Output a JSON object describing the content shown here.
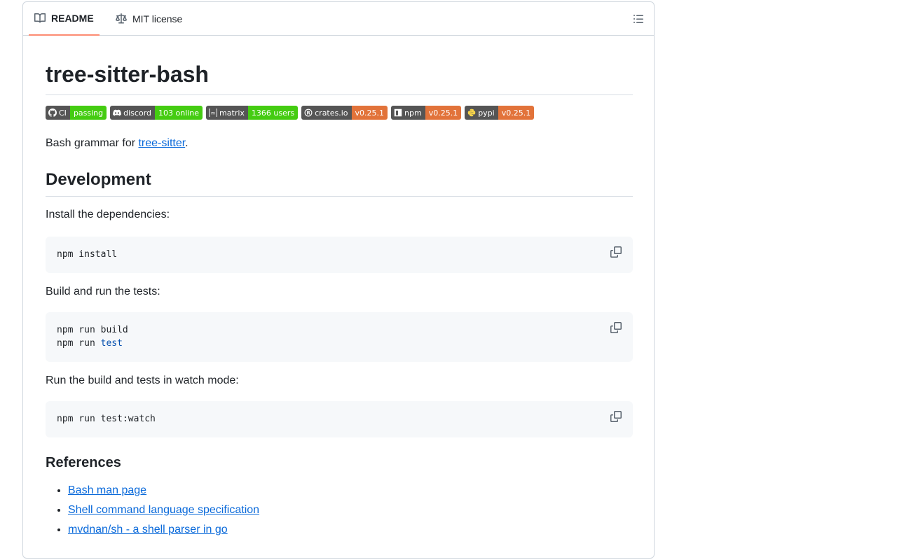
{
  "tabs": {
    "readme": "README",
    "license": "MIT license"
  },
  "readme": {
    "title": "tree-sitter-bash",
    "badges": [
      {
        "left": "CI",
        "right": "passing",
        "color": "#4c1",
        "icon": "github-icon"
      },
      {
        "left": "discord",
        "right": "103 online",
        "color": "#4c1",
        "icon": "discord-icon"
      },
      {
        "left": "matrix",
        "right": "1366 users",
        "color": "#4c1",
        "icon": "matrix-icon"
      },
      {
        "left": "crates.io",
        "right": "v0.25.1",
        "color": "#e2733a",
        "icon": "rust-icon"
      },
      {
        "left": "npm",
        "right": "v0.25.1",
        "color": "#e2733a",
        "icon": "npm-icon"
      },
      {
        "left": "pypi",
        "right": "v0.25.1",
        "color": "#e2733a",
        "icon": "python-icon"
      }
    ],
    "intro_prefix": "Bash grammar for ",
    "intro_link": "tree-sitter",
    "intro_suffix": ".",
    "development_heading": "Development",
    "install_text": "Install the dependencies:",
    "install_code": [
      "npm install"
    ],
    "build_text": "Build and run the tests:",
    "build_code_1": "npm run build",
    "build_code_2_prefix": "npm run ",
    "build_code_2_kw": "test",
    "watch_text": "Run the build and tests in watch mode:",
    "watch_code": "npm run test:watch",
    "references_heading": "References",
    "references": [
      "Bash man page",
      "Shell command language specification",
      "mvdnan/sh - a shell parser in go"
    ]
  }
}
